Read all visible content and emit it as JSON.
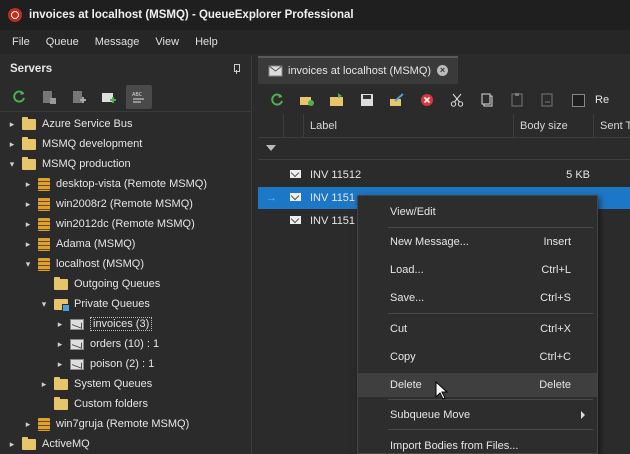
{
  "window": {
    "title": "invoices at localhost (MSMQ) - QueueExplorer Professional",
    "brand_color": "#c42b1c",
    "accent_color": "#1d77c7"
  },
  "menu": [
    "File",
    "Queue",
    "Message",
    "View",
    "Help"
  ],
  "servers_panel": {
    "title": "Servers",
    "toolbar": {
      "refresh_icon": "refresh-icon",
      "abc_sort_glyph": "ABC"
    },
    "tree": [
      {
        "label": "Azure Service Bus",
        "expanded": false,
        "icon": "folder-icon"
      },
      {
        "label": "MSMQ development",
        "expanded": false,
        "icon": "folder-icon"
      },
      {
        "label": "MSMQ production",
        "expanded": true,
        "icon": "folder-icon"
      },
      {
        "label": "desktop-vista (Remote MSMQ)",
        "icon": "server-icon"
      },
      {
        "label": "win2008r2 (Remote MSMQ)",
        "icon": "server-icon"
      },
      {
        "label": "win2012dc (Remote MSMQ)",
        "icon": "server-icon"
      },
      {
        "label": "Adama (MSMQ)",
        "icon": "server-icon"
      },
      {
        "label": "localhost (MSMQ)",
        "expanded": true,
        "icon": "server-icon"
      },
      {
        "label": "Outgoing Queues",
        "icon": "folder-icon"
      },
      {
        "label": "Private Queues",
        "expanded": true,
        "icon": "folder-icon"
      },
      {
        "label": "invoices (3)",
        "icon": "queue-icon",
        "selected": true
      },
      {
        "label": "orders (10) : 1",
        "icon": "queue-icon"
      },
      {
        "label": "poison (2) : 1",
        "icon": "queue-icon"
      },
      {
        "label": "System Queues",
        "icon": "folder-icon"
      },
      {
        "label": "Custom folders",
        "icon": "folder-icon"
      },
      {
        "label": "win7gruja (Remote MSMQ)",
        "icon": "server-icon"
      },
      {
        "label": "ActiveMQ",
        "icon": "folder-icon"
      }
    ]
  },
  "document": {
    "tab_label": "invoices at localhost (MSMQ)",
    "toolbar_checkbox_label": "Re",
    "columns": [
      "Label",
      "Body size",
      "Sent T"
    ],
    "rows": [
      {
        "label": "INV 11512",
        "size": "5 KB",
        "selected": false
      },
      {
        "label": "INV 1151",
        "size": "",
        "selected": true
      },
      {
        "label": "INV 1151",
        "size": "",
        "selected": false
      }
    ]
  },
  "context_menu": {
    "items": [
      {
        "label": "View/Edit",
        "shortcut": ""
      },
      {
        "label": "New Message...",
        "shortcut": "Insert"
      },
      {
        "label": "Load...",
        "shortcut": "Ctrl+L"
      },
      {
        "label": "Save...",
        "shortcut": "Ctrl+S"
      },
      {
        "label": "Cut",
        "shortcut": "Ctrl+X"
      },
      {
        "label": "Copy",
        "shortcut": "Ctrl+C"
      },
      {
        "label": "Delete",
        "shortcut": "Delete",
        "hover": true
      },
      {
        "label": "Subqueue Move",
        "shortcut": "",
        "submenu": true
      },
      {
        "label": "Import Bodies from Files...",
        "shortcut": ""
      }
    ]
  }
}
